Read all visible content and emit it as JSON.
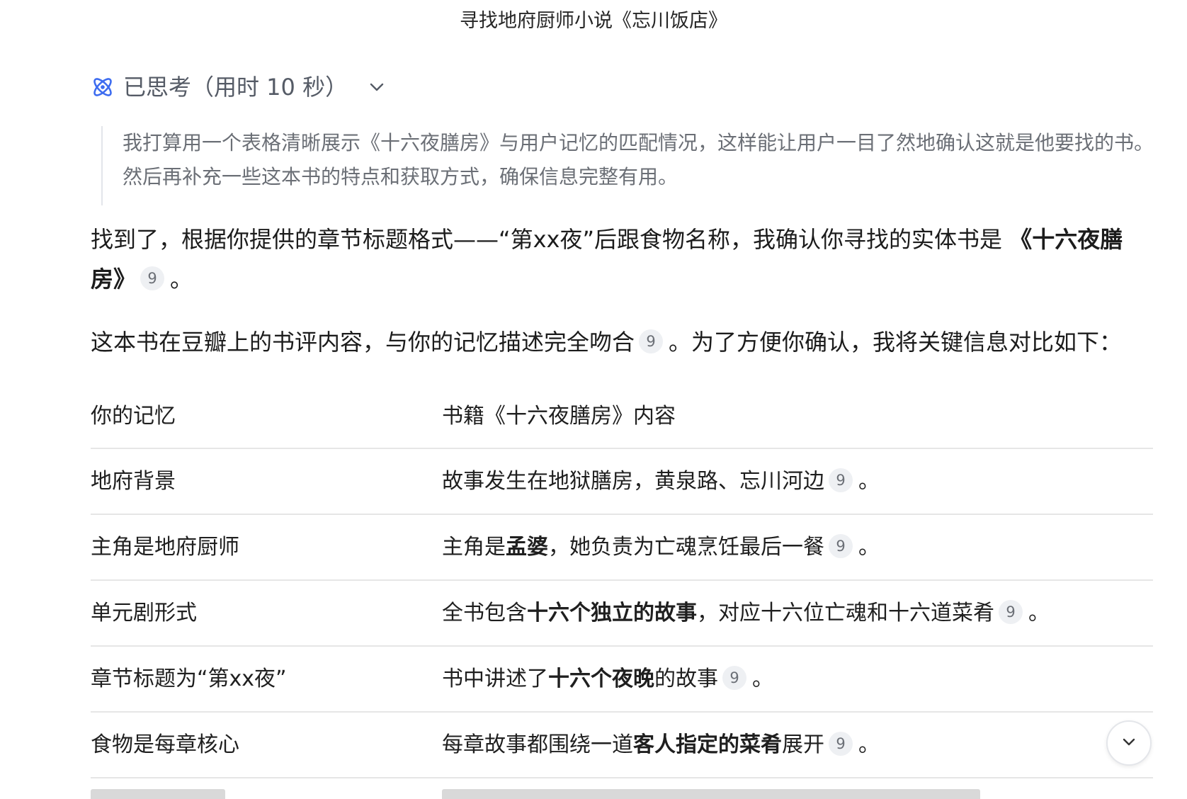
{
  "header": {
    "title": "寻找地府厨师小说《忘川饭店》"
  },
  "thinking": {
    "label": "已思考（用时 10 秒）",
    "line1": "我打算用一个表格清晰展示《十六夜膳房》与用户记忆的匹配情况，这样能让用户一目了然地确认这就是他要找的书。",
    "line2": "然后再补充一些这本书的特点和获取方式，确保信息完整有用。"
  },
  "answer": {
    "p1_text": "找到了，根据你提供的章节标题格式——“第xx夜”后跟食物名称，我确认你寻找的实体书是 ",
    "p1_book": "《十六夜膳房》",
    "p1_end": "。",
    "p2_text": "这本书在豆瓣上的书评内容，与你的记忆描述完全吻合",
    "p2_end": "。为了方便你确认，我将关键信息对比如下：",
    "citation": "9"
  },
  "table": {
    "headers": [
      "你的记忆",
      "书籍《十六夜膳房》内容"
    ],
    "rows": [
      {
        "left": "地府背景",
        "pre": "故事发生在地狱膳房，黄泉路、忘川河边",
        "bold": "",
        "post": "",
        "end": "。"
      },
      {
        "left": "主角是地府厨师",
        "pre": "主角是",
        "bold": "孟婆",
        "post": "，她负责为亡魂烹饪最后一餐",
        "end": "。"
      },
      {
        "left": "单元剧形式",
        "pre": "全书包含",
        "bold": "十六个独立的故事",
        "post": "，对应十六位亡魂和十六道菜肴",
        "end": "。"
      },
      {
        "left": "章节标题为“第xx夜”",
        "pre": "书中讲述了",
        "bold": "十六个夜晚",
        "post": "的故事",
        "end": "。"
      },
      {
        "left": "食物是每章核心",
        "pre": "每章故事都围绕一道",
        "bold": "客人指定的菜肴",
        "post": "展开",
        "end": "。"
      }
    ]
  },
  "colors": {
    "accent": "#3d6cf0",
    "muted": "#6b6f76",
    "divider": "#e6e6e6"
  },
  "icons": {
    "thinking": "atom-icon",
    "collapse": "chevron-down-icon",
    "scroll": "chevron-down-icon"
  }
}
